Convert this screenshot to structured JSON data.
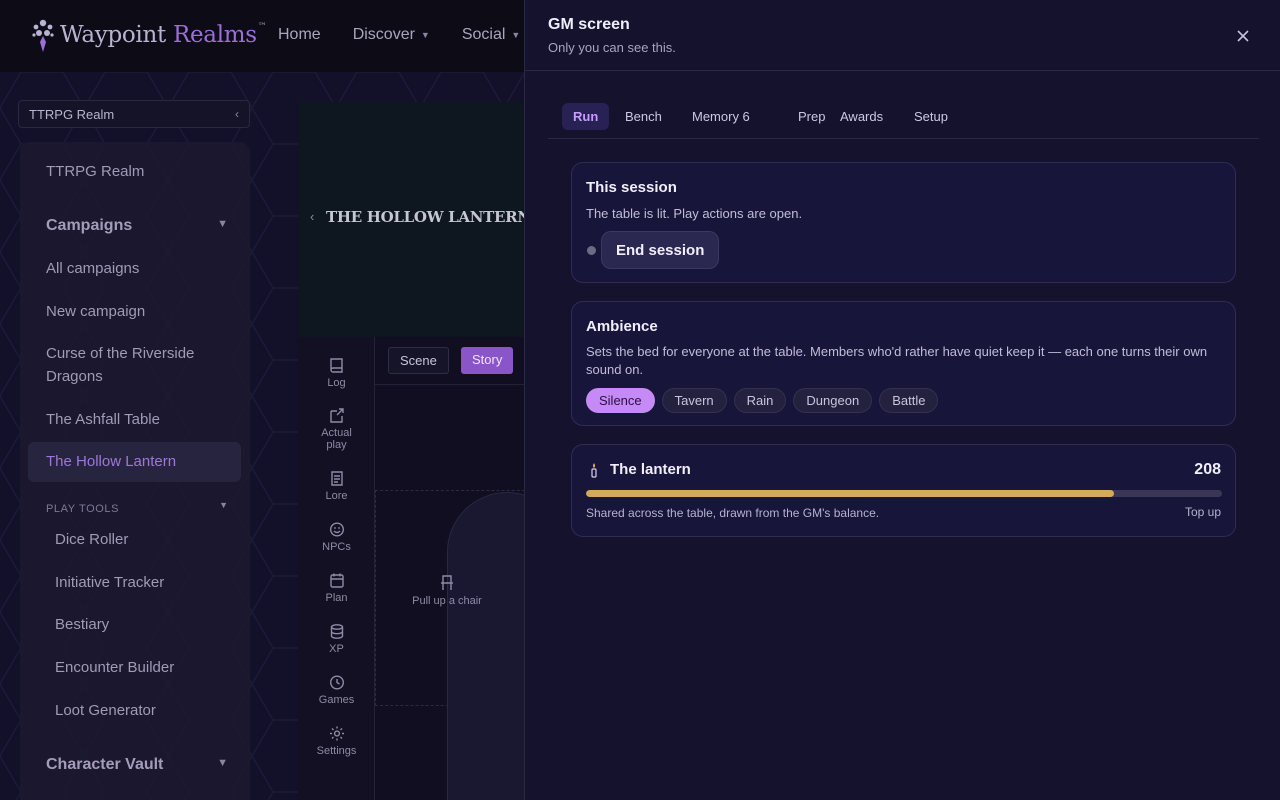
{
  "brand": {
    "name_part1": "Waypoint",
    "name_part2": " Realms",
    "trademark": "™"
  },
  "topnav": [
    {
      "label": "Home"
    },
    {
      "label": "Discover"
    },
    {
      "label": "Social"
    }
  ],
  "realm_select": {
    "label": "TTRPG Realm"
  },
  "sidebar": {
    "root_label": "TTRPG Realm",
    "campaigns_heading": "Campaigns",
    "campaigns": [
      {
        "label": "All campaigns"
      },
      {
        "label": "New campaign"
      },
      {
        "label": "Curse of the Riverside Dragons"
      },
      {
        "label": "The Ashfall Table"
      },
      {
        "label": "The Hollow Lantern"
      }
    ],
    "play_tools_heading": "PLAY TOOLS",
    "play_tools": [
      {
        "label": "Dice Roller"
      },
      {
        "label": "Initiative Tracker"
      },
      {
        "label": "Bestiary"
      },
      {
        "label": "Encounter Builder"
      },
      {
        "label": "Loot Generator"
      }
    ],
    "character_vault_heading": "Character Vault"
  },
  "hero": {
    "title": "THE HOLLOW LANTERN"
  },
  "rail": [
    {
      "label": "Log",
      "icon": "book-icon"
    },
    {
      "label": "Actual play",
      "icon": "share-icon"
    },
    {
      "label": "Lore",
      "icon": "scroll-icon"
    },
    {
      "label": "NPCs",
      "icon": "smile-icon"
    },
    {
      "label": "Plan",
      "icon": "calendar-icon"
    },
    {
      "label": "XP",
      "icon": "database-icon"
    },
    {
      "label": "Games",
      "icon": "clock-icon"
    },
    {
      "label": "Settings",
      "icon": "gear-icon"
    }
  ],
  "story": {
    "scene_label": "Scene",
    "story_label": "Story",
    "empty_label": "Pull up a chair"
  },
  "drawer": {
    "title": "GM screen",
    "subtitle": "Only you can see this.",
    "close_icon": "close-icon",
    "tabs": [
      {
        "label": "Run",
        "active": true
      },
      {
        "label": "Bench"
      },
      {
        "label": "Memory 6"
      },
      {
        "label": "Prep"
      },
      {
        "label": "Awards"
      },
      {
        "label": "Setup"
      }
    ],
    "session": {
      "title": "This session",
      "description": "The table is lit. Play actions are open.",
      "end_label": "End session"
    },
    "ambience": {
      "title": "Ambience",
      "description": "Sets the bed for everyone at the table. Members who'd rather have quiet keep it — each one turns their own sound on.",
      "options": [
        "Silence",
        "Tavern",
        "Rain",
        "Dungeon",
        "Battle"
      ],
      "selected": "Silence"
    },
    "lantern": {
      "title": "The lantern",
      "value": "208",
      "fill_fraction": 0.83,
      "note": "Shared across the table, drawn from the GM's balance.",
      "topup_label": "Top up"
    }
  },
  "colors": {
    "accent_purple": "#c58af5",
    "lantern_gold": "#d6a95a",
    "drawer_bg": "#14122d"
  }
}
